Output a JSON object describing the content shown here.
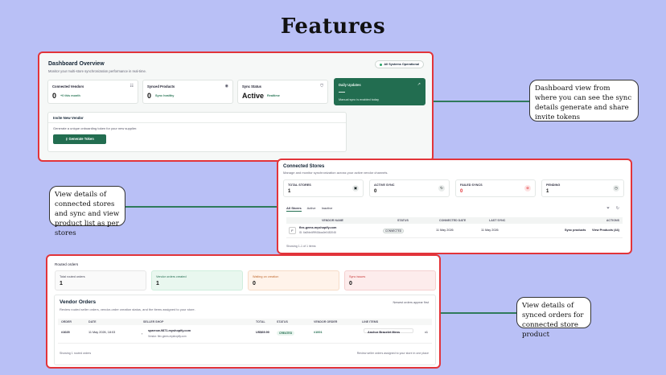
{
  "page_title": "Features",
  "notes": {
    "dashboard": "Dashboard view from where you can see the sync details generate and share invite tokens",
    "stores": "View details of connected stores and sync and view product list as per stores",
    "orders": "View details of synced orders for connected store product"
  },
  "dashboard": {
    "title": "Dashboard Overview",
    "subtitle": "Monitor your multi-store synchronization performance in real-time.",
    "status_pill": "All Systems Operational",
    "cards": [
      {
        "label": "Connected Vendors",
        "value": "0",
        "note": "+0 this month",
        "icon": "building-icon"
      },
      {
        "label": "Synced Products",
        "value": "0",
        "note": "Sync healthy",
        "icon": "eye-icon"
      },
      {
        "label": "Sync Status",
        "value": "Active",
        "note": "Realtime",
        "icon": "shield-icon"
      },
      {
        "label": "Daily Updates",
        "value": "—",
        "note": "Manual sync is enabled today",
        "icon": "trend-icon"
      }
    ],
    "invite": {
      "title": "Invite New Vendor",
      "subtitle": "Generate a unique onboarding token for your new supplier.",
      "button": "Generate Token"
    }
  },
  "stores": {
    "title": "Connected Stores",
    "subtitle": "Manage and monitor synchronization across your active vendor channels.",
    "stats": [
      {
        "label": "TOTAL STORES",
        "value": "1",
        "color": "#e9eceb",
        "glyph": "▣"
      },
      {
        "label": "ACTIVE SYNC",
        "value": "0",
        "color": "#e9eceb",
        "glyph": "↻"
      },
      {
        "label": "FAILED SYNCS",
        "value": "0",
        "color": "#fde3e3",
        "glyph": "⊗",
        "value_color": "#e2343a"
      },
      {
        "label": "PENDING",
        "value": "1",
        "color": "#e9eceb",
        "glyph": "◷"
      }
    ],
    "tabs": [
      "All Stores",
      "Active",
      "Inactive"
    ],
    "columns": [
      "VENDOR NAME",
      "STATUS",
      "CONNECTED DATE",
      "LAST SYNC",
      "ACTIONS"
    ],
    "rows": [
      {
        "initial": "F",
        "name": "flex-gems.myshopify.com",
        "id": "ID: 6a0fde4f9ff43daa0e0482048",
        "status": "CONNECTED",
        "connected": "11 May 2026",
        "last_sync": "11 May 2026",
        "action1": "Sync products",
        "action2": "View Products (44)"
      }
    ],
    "footer": "Showing 1-1 of 1 items"
  },
  "orders": {
    "label": "Routed orders",
    "cards": [
      {
        "label": "Total routed orders",
        "value": "1",
        "bg": "#fafafa",
        "border": "#e6e6e6"
      },
      {
        "label": "Vendor orders created",
        "value": "1",
        "bg": "#e9f7ef",
        "border": "#cfeedd"
      },
      {
        "label": "Waiting on creation",
        "value": "0",
        "bg": "#fff3ea",
        "border": "#f6dcc8"
      },
      {
        "label": "Sync issues",
        "value": "0",
        "bg": "#fdecec",
        "border": "#f5d0d0"
      }
    ],
    "section_title": "Vendor Orders",
    "section_sub": "Review routed seller orders, vendor-order creation status, and the items assigned to your store.",
    "section_right": "Newest orders appear first",
    "columns": [
      "ORDER",
      "DATE",
      "SELLER SHOP",
      "TOTAL",
      "STATUS",
      "VENDOR ORDER",
      "LINE ITEMS"
    ],
    "rows": [
      {
        "order": "#1025",
        "date": "11 May 2026, 18:03",
        "shop": "sparrow-9871.myshopify.com",
        "shop_sub": "Vendor: flex-gems.myshopify.com",
        "total": "US$69.90",
        "status": "CREATED",
        "vendor_order": "#1001",
        "item": "Anchor Bracelet Mens",
        "qty": "x1"
      }
    ],
    "footer_left": "Showing 1 routed orders",
    "footer_right": "Review seller orders assigned to your store in one place"
  }
}
